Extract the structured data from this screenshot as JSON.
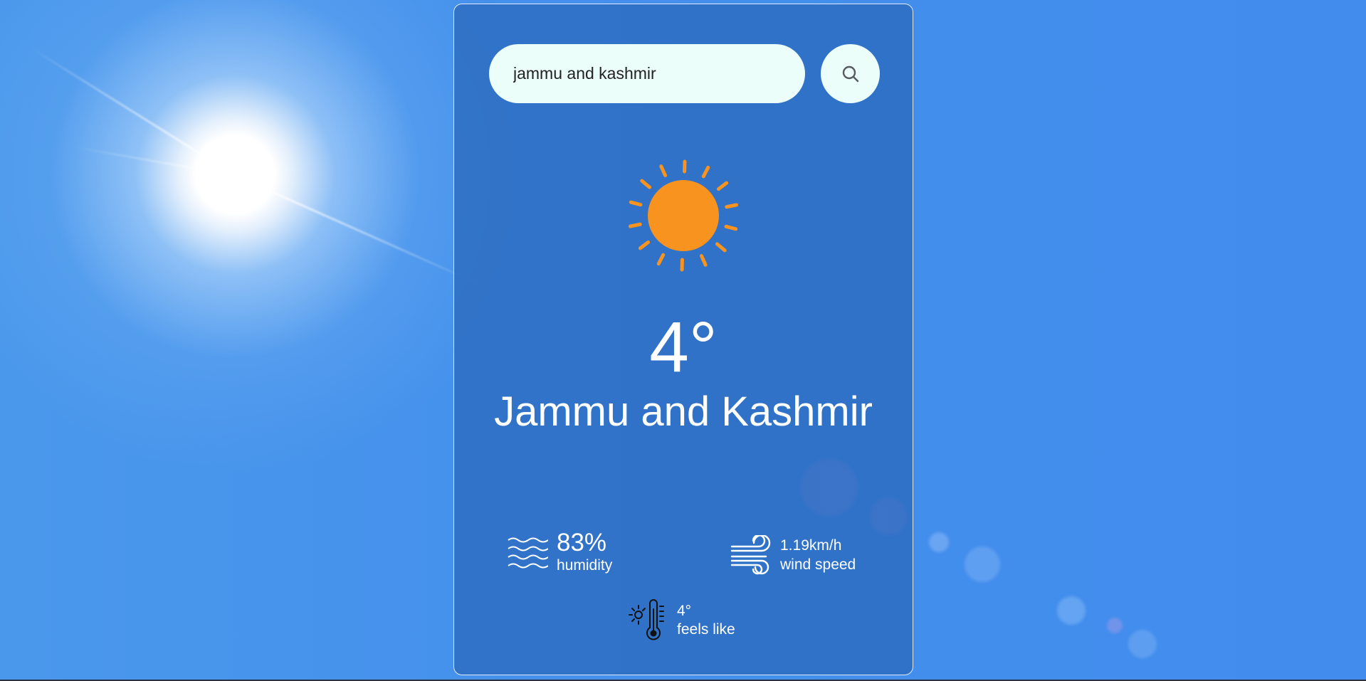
{
  "search": {
    "value": "jammu and kashmir",
    "button_icon": "search-icon"
  },
  "weather": {
    "icon": "sun-icon",
    "temperature": "4°",
    "city": "Jammu and Kashmir"
  },
  "details": {
    "humidity": {
      "icon": "humidity-waves-icon",
      "value": "83%",
      "label": "humidity"
    },
    "wind": {
      "icon": "wind-icon",
      "value": "1.19km/h",
      "label": "wind speed"
    },
    "feels_like": {
      "icon": "thermometer-sun-icon",
      "value": "4°",
      "label": "feels like"
    }
  },
  "colors": {
    "sky": "#4490ec",
    "card": "#2c6abe",
    "input_bg": "#ebfefa",
    "sun": "#f7931e",
    "text": "#ffffff"
  }
}
